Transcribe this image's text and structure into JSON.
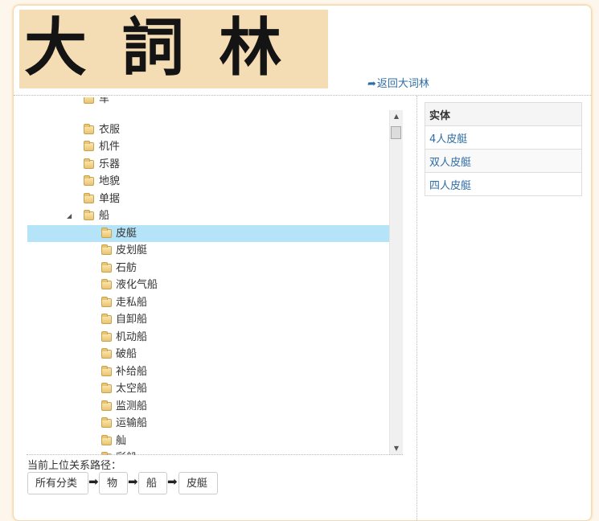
{
  "header": {
    "logo_text": "大 詞 林",
    "back_link_label": "返回大词林",
    "back_icon": "share-arrow-icon"
  },
  "tree": {
    "top_partial": "车",
    "siblings": [
      "衣服",
      "机件",
      "乐器",
      "地貌",
      "单据"
    ],
    "expanded_parent": "船",
    "expanded_icon": "triangle-down-icon",
    "folder_icon": "folder-icon",
    "children": [
      "皮艇",
      "皮划艇",
      "石舫",
      "液化气船",
      "走私船",
      "自卸船",
      "机动船",
      "破船",
      "补给船",
      "太空船",
      "监测船",
      "运输船",
      "舢",
      "彩船"
    ],
    "selected": "皮艇"
  },
  "scrollbar": {
    "up_icon": "triangle-up-icon",
    "down_icon": "triangle-down-icon"
  },
  "path": {
    "title": "当前上位关系路径：",
    "crumbs": [
      "所有分类",
      "物",
      "船",
      "皮艇"
    ],
    "separator_icon": "arrow-right-icon"
  },
  "entities": {
    "header": "实体",
    "items": [
      "4人皮艇",
      "双人皮艇",
      "四人皮艇"
    ]
  },
  "colors": {
    "page_bg": "#fdf6ec",
    "banner_bg": "#f4dcb4",
    "selected_bg": "#b5e3f7",
    "link": "#2e6da4"
  }
}
